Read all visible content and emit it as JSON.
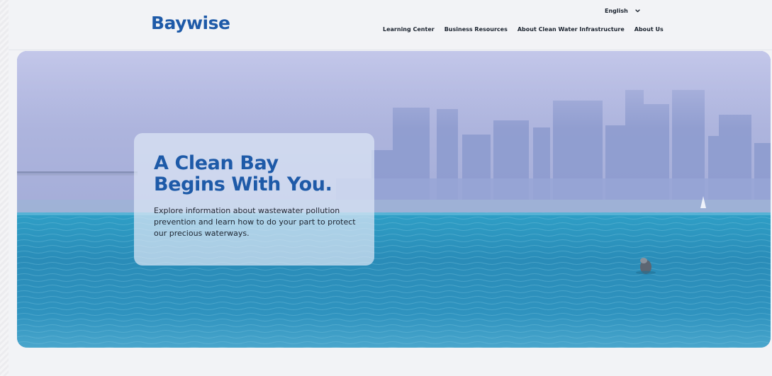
{
  "header": {
    "logo_text": "Baywise",
    "language": {
      "selected": "English",
      "icon": "chevron-down-icon"
    },
    "nav": [
      {
        "label": "Learning Center"
      },
      {
        "label": "Business Resources"
      },
      {
        "label": "About Clean Water Infrastructure"
      },
      {
        "label": "About Us"
      }
    ]
  },
  "hero": {
    "title_line1": "A Clean Bay",
    "title_line2": "Begins With You.",
    "description": "Explore information about wastewater pollution prevention and learn how to do your part to protect our precious waterways.",
    "image": "bay-skyline-with-seal"
  },
  "colors": {
    "brand_blue": "#1e5aa8",
    "text_dark": "#1c2430",
    "page_bg": "#f2f3f6",
    "water": "#2a8fb8",
    "sky": "#a7afd9"
  }
}
